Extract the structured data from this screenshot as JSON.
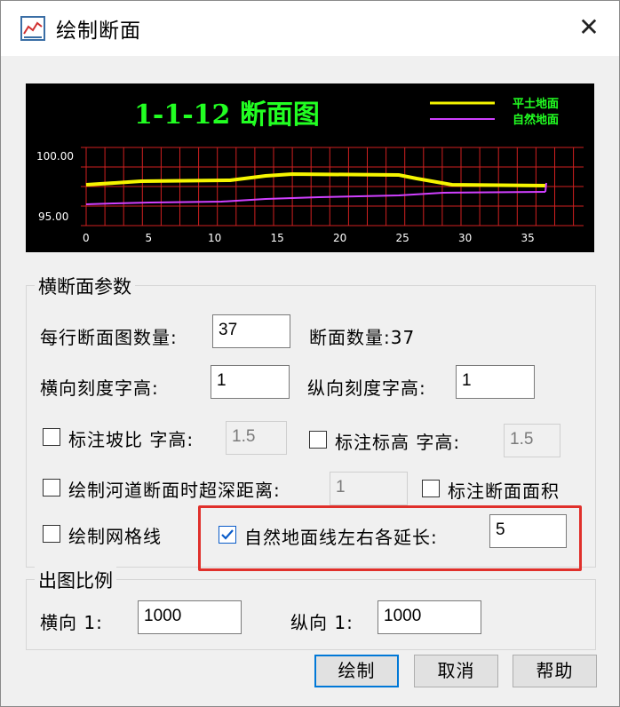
{
  "window": {
    "title": "绘制断面",
    "close_glyph": "✕"
  },
  "preview": {
    "title": "1-1-12 断面图",
    "legend": [
      "平土地面",
      "自然地面"
    ],
    "y_labels": [
      "100.00",
      "95.00"
    ],
    "x_labels": [
      "0",
      "5",
      "10",
      "15",
      "20",
      "25",
      "30",
      "35"
    ],
    "colors": {
      "fill_line": "#f5f500",
      "natural_line": "#d040ff",
      "title": "#22ff22",
      "grid": "#d02020",
      "text": "#ffffff"
    }
  },
  "cross_section": {
    "legend": "横断面参数",
    "per_row_label": "每行断面图数量:",
    "per_row_value": "37",
    "count_label": "断面数量:37",
    "h_tick_label": "横向刻度字高:",
    "h_tick_value": "1",
    "v_tick_label": "纵向刻度字高:",
    "v_tick_value": "1",
    "slope_label": "标注坡比 字高:",
    "slope_value": "1.5",
    "elev_label": "标注标高 字高:",
    "elev_value": "1.5",
    "river_label": "绘制河道断面时超深距离:",
    "river_value": "1",
    "area_label": "标注断面面积",
    "grid_label": "绘制网格线",
    "extend_label": "自然地面线左右各延长:",
    "extend_value": "5"
  },
  "scale": {
    "legend": "出图比例",
    "h_label": "横向 1:",
    "h_value": "1000",
    "v_label": "纵向 1:",
    "v_value": "1000"
  },
  "buttons": {
    "draw": "绘制",
    "cancel": "取消",
    "help": "帮助"
  }
}
